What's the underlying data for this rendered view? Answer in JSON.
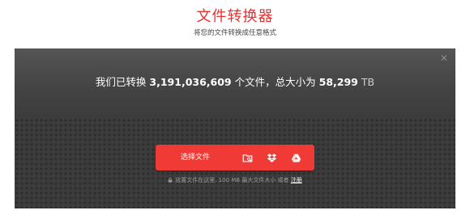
{
  "header": {
    "title": "文件转换器",
    "subtitle": "将您的文件转换成任意格式"
  },
  "stats": {
    "prefix": "我们已转换",
    "files_count": "3,191,036,609",
    "mid": "个文件，总大小为",
    "total_size": "58,299",
    "unit": "TB"
  },
  "upload": {
    "choose_label": "选择文件"
  },
  "hint": {
    "text": "放置文件在这里. 100 MB 最大文件大小 或者",
    "link": "注册"
  },
  "colors": {
    "accent": "#ef3a35",
    "title": "#e8302f",
    "panel": "#3b3b3b"
  },
  "icons": {
    "close": "close-icon",
    "folder": "folder-search-icon",
    "dropbox": "dropbox-icon",
    "gdrive": "google-drive-icon",
    "lock": "lock-icon"
  }
}
